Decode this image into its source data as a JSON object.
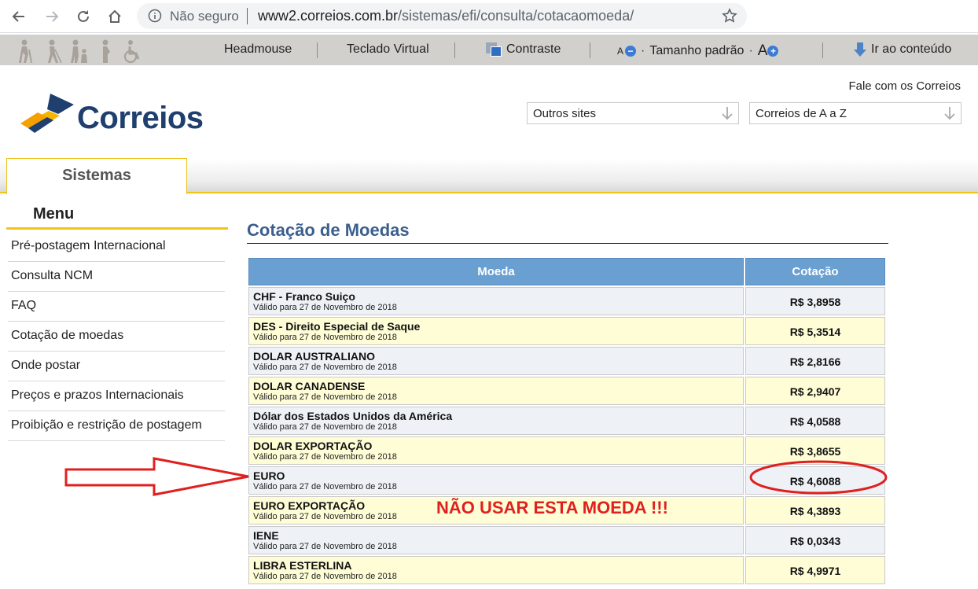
{
  "browser": {
    "security": "Não seguro",
    "url_host": "www2.correios.com.br",
    "url_path": "/sistemas/efi/consulta/cotacaomoeda/"
  },
  "accessibility": {
    "headmouse": "Headmouse",
    "teclado": "Teclado Virtual",
    "contraste": "Contraste",
    "font_small": "A",
    "tamanho": "Tamanho padrão",
    "font_large": "A",
    "ir_conteudo": "Ir ao conteúdo"
  },
  "header": {
    "fale": "Fale com os Correios",
    "logo_text": "Correios",
    "select_outros": "Outros sites",
    "select_az": "Correios de A a Z"
  },
  "tabs": {
    "sistemas": "Sistemas"
  },
  "menu": {
    "title": "Menu",
    "items": [
      "Pré-postagem Internacional",
      "Consulta NCM",
      "FAQ",
      "Cotação de moedas",
      "Onde postar",
      "Preços e prazos Internacionais",
      "Proibição e restrição de postagem"
    ]
  },
  "content": {
    "title": "Cotação de Moedas",
    "col_moeda": "Moeda",
    "col_cotacao": "Cotação",
    "rows": [
      {
        "name": "CHF - Franco Suiço",
        "valid": "Válido para 27 de Novembro de 2018",
        "value": "R$ 3,8958"
      },
      {
        "name": "DES - Direito Especial de Saque",
        "valid": "Válido para 27 de Novembro de 2018",
        "value": "R$ 5,3514"
      },
      {
        "name": "DOLAR AUSTRALIANO",
        "valid": "Válido para 27 de Novembro de 2018",
        "value": "R$ 2,8166"
      },
      {
        "name": "DOLAR CANADENSE",
        "valid": "Válido para 27 de Novembro de 2018",
        "value": "R$ 2,9407"
      },
      {
        "name": "Dólar dos Estados Unidos da América",
        "valid": "Válido para 27 de Novembro de 2018",
        "value": "R$ 4,0588"
      },
      {
        "name": "DOLAR EXPORTAÇÃO",
        "valid": "Válido para 27 de Novembro de 2018",
        "value": "R$ 3,8655"
      },
      {
        "name": "EURO",
        "valid": "Válido para 27 de Novembro de 2018",
        "value": "R$ 4,6088"
      },
      {
        "name": "EURO EXPORTAÇÃO",
        "valid": "Válido para 27 de Novembro de 2018",
        "value": "R$ 4,3893"
      },
      {
        "name": "IENE",
        "valid": "Válido para 27 de Novembro de 2018",
        "value": "R$ 0,0343"
      },
      {
        "name": "LIBRA ESTERLINA",
        "valid": "Válido para 27 de Novembro de 2018",
        "value": "R$ 4,9971"
      }
    ]
  },
  "annotation": {
    "warning": "NÃO USAR ESTA MOEDA !!!",
    "color": "#e02020"
  }
}
